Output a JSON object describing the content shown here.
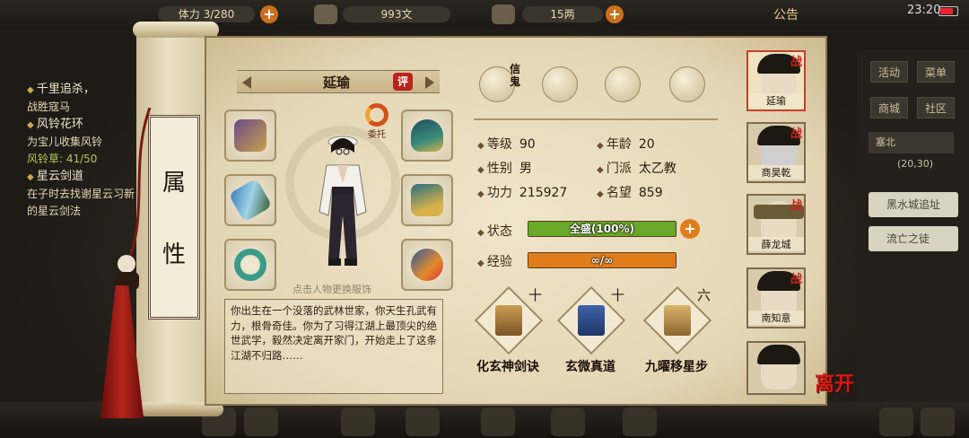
{
  "top_bar": {
    "stamina_label": "体力",
    "stamina_value": "3/280",
    "money_copper": "993文",
    "money_silver": "15两",
    "notice": "公告",
    "clock": "23:20"
  },
  "quests": [
    {
      "title": "千里追杀，",
      "desc": "战胜寇马"
    },
    {
      "title": "风铃花环",
      "desc": "为宝儿收集风铃",
      "progress": "风铃草: 41/50"
    },
    {
      "title": "星云剑道",
      "desc": "在子时去找谢星云习新的星云剑法"
    }
  ],
  "scroll": {
    "tab_chars": [
      "属",
      "性"
    ]
  },
  "character": {
    "name": "延瑜",
    "rate_label": "评",
    "delegate_label": "委托",
    "tap_hint": "点击人物更换服饰",
    "bio": "你出生在一个没落的武林世家，你天生孔武有力，根骨奇佳。你为了习得江湖上最顶尖的绝世武学，毅然决定离开家门，开始走上了这条江湖不归路……"
  },
  "quick_icons": [
    {
      "icon": "bamboo-hat-icon",
      "badge": "信鬼"
    },
    {
      "icon": "map-scroll-icon"
    },
    {
      "icon": "bagua-icon"
    },
    {
      "icon": "meridian-figure-icon"
    }
  ],
  "stats": {
    "level_label": "等级",
    "level_value": "90",
    "age_label": "年龄",
    "age_value": "20",
    "gender_label": "性别",
    "gender_value": "男",
    "sect_label": "门派",
    "sect_value": "太乙教",
    "power_label": "功力",
    "power_value": "215927",
    "fame_label": "名望",
    "fame_value": "859"
  },
  "status_bar": {
    "label": "状态",
    "text": "全盛(100%)",
    "fill": 1.0,
    "color": "#6aa82a"
  },
  "exp_bar": {
    "label": "经验",
    "text": "∞/∞",
    "fill": 1.0,
    "color": "#e07d1a"
  },
  "skills": [
    {
      "name": "化玄神剑诀",
      "level": "十"
    },
    {
      "name": "玄微真道",
      "level": "十"
    },
    {
      "name": "九曜移星步",
      "level": "六"
    }
  ],
  "team": [
    {
      "name": "延瑜",
      "tag": "战",
      "active": true
    },
    {
      "name": "商昊乾",
      "tag": "战"
    },
    {
      "name": "薛龙城",
      "tag": "战"
    },
    {
      "name": "南知意",
      "tag": "战"
    },
    {
      "name": ""
    }
  ],
  "leave_label": "离开",
  "right_menu": {
    "activity": "活动",
    "menu": "菜单",
    "shop": "商城",
    "community": "社区",
    "location": "塞北",
    "location_coords": "(20,30)",
    "tags": [
      "黑水城追址",
      "流亡之徒"
    ]
  },
  "colors": {
    "accent_red": "#b8241a",
    "parchment": "#e9dcbc",
    "status_green": "#6aa82a",
    "exp_orange": "#e07d1a"
  }
}
